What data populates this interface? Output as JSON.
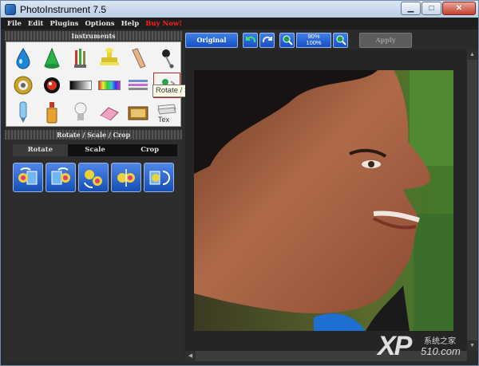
{
  "window": {
    "title": "PhotoInstrument 7.5"
  },
  "menu": [
    {
      "label": "File"
    },
    {
      "label": "Edit"
    },
    {
      "label": "Plugins"
    },
    {
      "label": "Options"
    },
    {
      "label": "Help"
    },
    {
      "label": "Buy Now!"
    }
  ],
  "instruments": {
    "header": "Instruments",
    "tools": [
      {
        "icon": "drop-icon"
      },
      {
        "icon": "cone-icon"
      },
      {
        "icon": "brushes-icon"
      },
      {
        "icon": "stamp-icon"
      },
      {
        "icon": "finger-icon"
      },
      {
        "icon": "pin-icon"
      },
      {
        "icon": "gear-eye-icon"
      },
      {
        "icon": "eye-icon"
      },
      {
        "icon": "gradient-icon"
      },
      {
        "icon": "color-bars-icon"
      },
      {
        "icon": "lines-icon"
      },
      {
        "icon": "rotate-scale-crop-icon"
      },
      {
        "icon": "tube-icon"
      },
      {
        "icon": "bottle-icon"
      },
      {
        "icon": "bulb-icon"
      },
      {
        "icon": "eraser-icon"
      },
      {
        "icon": "box-icon"
      },
      {
        "icon": "text-icon"
      }
    ],
    "tooltip": "Rotate / Scale / Crop",
    "text_tool_label": "Tex"
  },
  "rotate_panel": {
    "header": "Rotate / Scale / Crop",
    "tabs": [
      {
        "label": "Rotate"
      },
      {
        "label": "Scale"
      },
      {
        "label": "Crop"
      }
    ],
    "actions": [
      {
        "icon": "rotate-left-icon"
      },
      {
        "icon": "rotate-right-icon"
      },
      {
        "icon": "rotate-180-icon"
      },
      {
        "icon": "flip-vertical-icon"
      },
      {
        "icon": "flip-horizontal-icon"
      }
    ]
  },
  "toolbar": {
    "original_label": "Original",
    "undo_icon": "undo-icon",
    "redo_icon": "redo-icon",
    "zoom_in_icon": "zoom-in-icon",
    "zoom_out_icon": "zoom-out-icon",
    "zoom_current": "90%",
    "zoom_default": "100%",
    "apply_label": "Apply"
  },
  "watermark": {
    "logo": "XP",
    "subtitle": "系统之家",
    "url": "510.com"
  },
  "colors": {
    "accent": "#1750c3",
    "titlebar": "#c4d6ea",
    "panel": "#2d2d2d",
    "close": "#c4412f"
  }
}
